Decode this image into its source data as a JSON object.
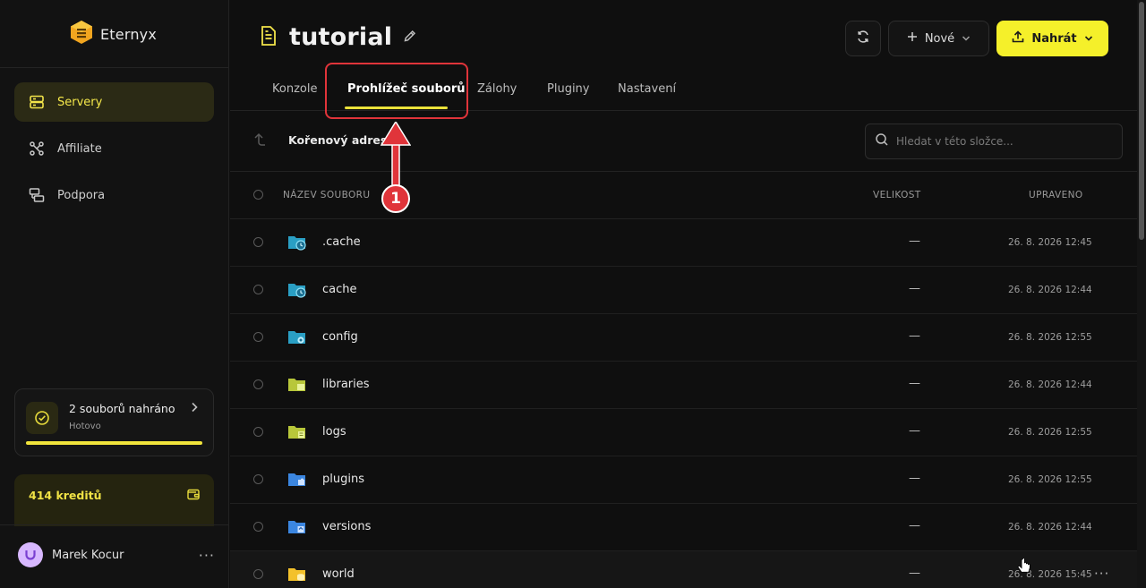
{
  "brand": {
    "name": "Eternyx"
  },
  "sidebar": {
    "items": [
      {
        "label": "Servery",
        "icon": "server-icon",
        "active": true
      },
      {
        "label": "Affiliate",
        "icon": "affiliate-icon",
        "active": false
      },
      {
        "label": "Podpora",
        "icon": "support-icon",
        "active": false
      }
    ],
    "upload_status": {
      "title": "2 souborů nahráno",
      "subtitle": "Hotovo",
      "progress": 1.0
    },
    "credits": {
      "label": "414 kreditů"
    },
    "user": {
      "name": "Marek Kocur"
    }
  },
  "header": {
    "title": "tutorial",
    "new_label": "Nové",
    "upload_label": "Nahrát"
  },
  "tabs": [
    {
      "label": "Konzole",
      "active": false
    },
    {
      "label": "Prohlížeč souborů",
      "active": true
    },
    {
      "label": "Zálohy",
      "active": false
    },
    {
      "label": "Pluginy",
      "active": false
    },
    {
      "label": "Nastavení",
      "active": false
    }
  ],
  "toolbar": {
    "breadcrumb": "Kořenový adresář",
    "search_placeholder": "Hledat v této složce..."
  },
  "table": {
    "columns": {
      "name": "NÁZEV SOUBORU",
      "size": "VELIKOST",
      "modified": "UPRAVENO"
    },
    "rows": [
      {
        "name": ".cache",
        "size": "—",
        "modified": "26. 8. 2026 12:45",
        "icon": "folder-clock-icon"
      },
      {
        "name": "cache",
        "size": "—",
        "modified": "26. 8. 2026 12:44",
        "icon": "folder-clock-icon"
      },
      {
        "name": "config",
        "size": "—",
        "modified": "26. 8. 2026 12:55",
        "icon": "folder-gear-icon"
      },
      {
        "name": "libraries",
        "size": "—",
        "modified": "26. 8. 2026 12:44",
        "icon": "folder-library-icon"
      },
      {
        "name": "logs",
        "size": "—",
        "modified": "26. 8. 2026 12:55",
        "icon": "folder-log-icon"
      },
      {
        "name": "plugins",
        "size": "—",
        "modified": "26. 8. 2026 12:55",
        "icon": "folder-plugin-icon"
      },
      {
        "name": "versions",
        "size": "—",
        "modified": "26. 8. 2026 12:44",
        "icon": "folder-upload-icon"
      },
      {
        "name": "world",
        "size": "—",
        "modified": "26. 8. 2026 15:45",
        "icon": "folder-world-icon"
      }
    ]
  },
  "annotation": {
    "number": "1"
  },
  "colors": {
    "accent": "#f5f02a",
    "annotation": "#e0343a",
    "background": "#0f0f0f"
  }
}
